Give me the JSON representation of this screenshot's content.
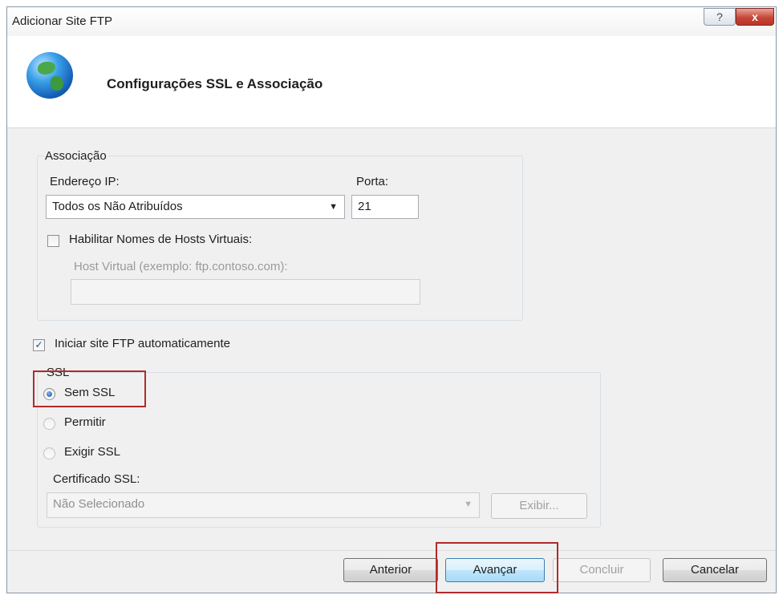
{
  "window": {
    "title": "Adicionar Site FTP",
    "help_label": "?",
    "close_label": "x"
  },
  "header": {
    "title": "Configurações SSL e Associação",
    "icon": "globe-icon"
  },
  "binding": {
    "group_label": "Associação",
    "ip_label": "Endereço IP:",
    "ip_value": "Todos os Não Atribuídos",
    "port_label": "Porta:",
    "port_value": "21",
    "virtual_hosts_label": "Habilitar Nomes de Hosts Virtuais:",
    "virtual_hosts_checked": false,
    "virtual_host_label": "Host Virtual (exemplo: ftp.contoso.com):",
    "virtual_host_value": ""
  },
  "autostart": {
    "label": "Iniciar site FTP automaticamente",
    "checked": true
  },
  "ssl": {
    "group_label": "SSL",
    "options": [
      {
        "label": "Sem SSL",
        "selected": true
      },
      {
        "label": "Permitir",
        "selected": false
      },
      {
        "label": "Exigir SSL",
        "selected": false
      }
    ],
    "certificate_label": "Certificado SSL:",
    "certificate_value": "Não Selecionado",
    "view_button": "Exibir..."
  },
  "footer": {
    "previous": "Anterior",
    "next": "Avançar",
    "finish": "Concluir",
    "cancel": "Cancelar"
  },
  "colors": {
    "highlight": "#b22a2a",
    "accent": "#3c7fb1"
  }
}
